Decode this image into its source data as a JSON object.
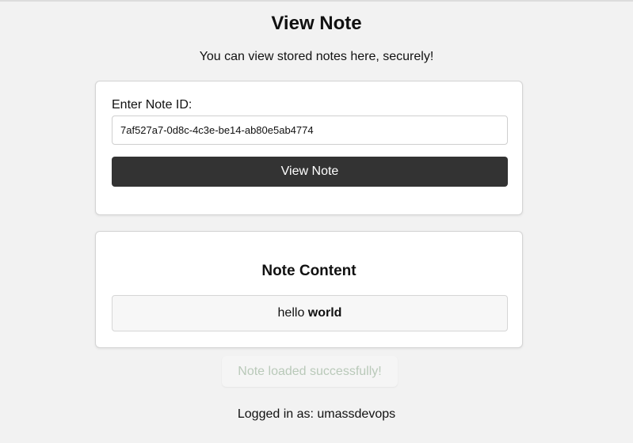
{
  "page": {
    "title": "View Note",
    "subtitle": "You can view stored notes here, securely!"
  },
  "form": {
    "label": "Enter Note ID:",
    "note_id_value": "7af527a7-0d8c-4c3e-be14-ab80e5ab4774",
    "button_label": "View Note"
  },
  "note": {
    "heading": "Note Content",
    "content_plain": "hello",
    "content_bold": "world"
  },
  "status": {
    "message": "Note loaded successfully!"
  },
  "footer": {
    "logged_in_text": "Logged in as: umassdevops"
  },
  "colors": {
    "background": "#f2f2f2",
    "button": "#333333",
    "status_text": "#b9c9b9"
  }
}
